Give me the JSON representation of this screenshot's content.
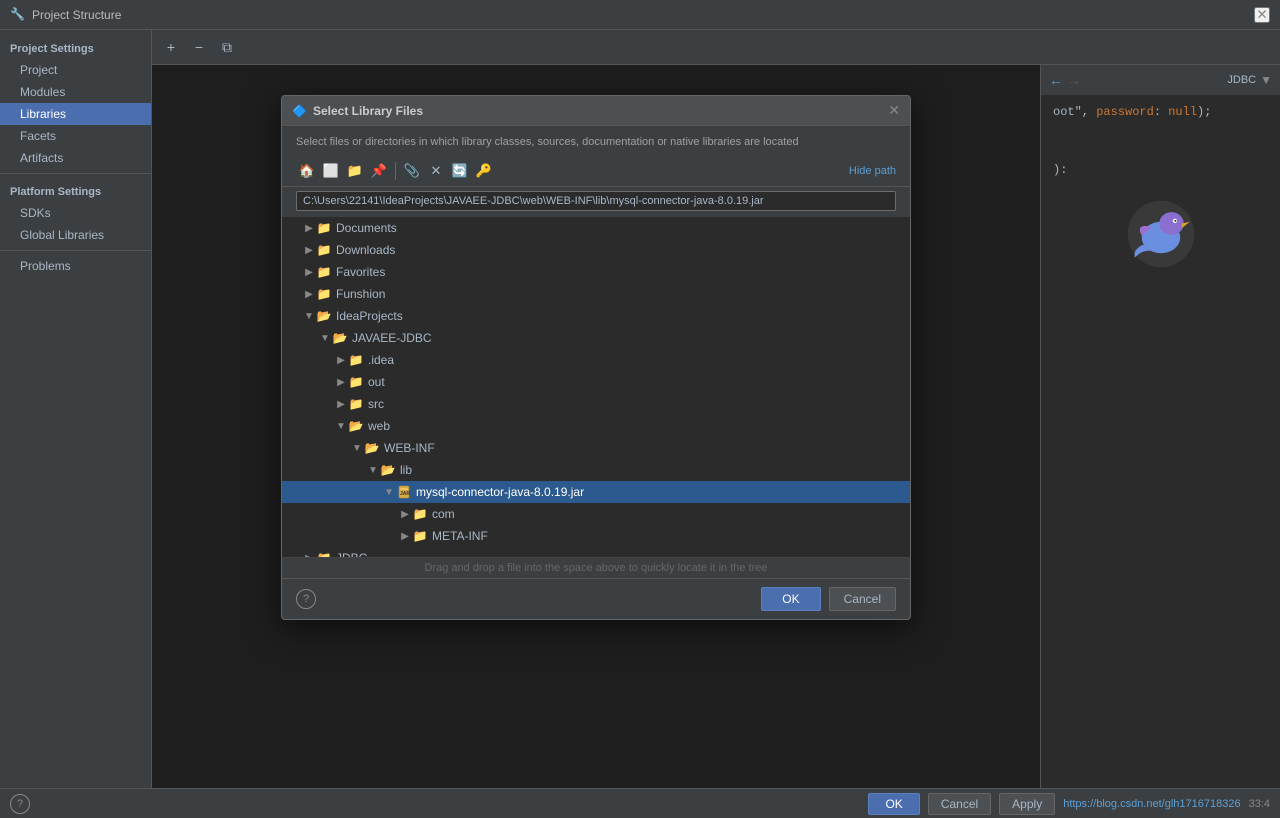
{
  "titlebar": {
    "icon": "🔧",
    "title": "Project Structure",
    "close_label": "✕"
  },
  "sidebar": {
    "project_settings_title": "Project Settings",
    "items_project": [
      {
        "id": "project",
        "label": "Project"
      },
      {
        "id": "modules",
        "label": "Modules"
      },
      {
        "id": "libraries",
        "label": "Libraries",
        "active": true
      },
      {
        "id": "facets",
        "label": "Facets"
      },
      {
        "id": "artifacts",
        "label": "Artifacts"
      }
    ],
    "platform_settings_title": "Platform Settings",
    "items_platform": [
      {
        "id": "sdks",
        "label": "SDKs"
      },
      {
        "id": "global-libraries",
        "label": "Global Libraries"
      }
    ],
    "problems_label": "Problems"
  },
  "toolbar": {
    "add_label": "+",
    "remove_label": "−",
    "copy_label": "⧉"
  },
  "right_panel": {
    "tab_label": "JDBC",
    "code_lines": [
      {
        "text": "oot\", password: null);"
      }
    ],
    "line_col": "33:4"
  },
  "dialog": {
    "title": "Select Library Files",
    "icon": "🔷",
    "description": "Select files or directories in which library classes, sources, documentation or native libraries are located",
    "hide_path_label": "Hide path",
    "path_value": "C:\\Users\\22141\\IdeaProjects\\JAVAEE-JDBC\\web\\WEB-INF\\lib\\mysql-connector-java-8.0.19.jar",
    "toolbar_btns": [
      "🏠",
      "⬜",
      "📁",
      "📌",
      "📎",
      "✕",
      "🔄",
      "🔑"
    ],
    "tree_items": [
      {
        "id": "documents",
        "label": "Documents",
        "depth": 1,
        "type": "folder-closed",
        "expanded": false,
        "toggle": "▶"
      },
      {
        "id": "downloads",
        "label": "Downloads",
        "depth": 1,
        "type": "folder-closed",
        "expanded": false,
        "toggle": "▶"
      },
      {
        "id": "favorites",
        "label": "Favorites",
        "depth": 1,
        "type": "folder-closed",
        "expanded": false,
        "toggle": "▶"
      },
      {
        "id": "funshion",
        "label": "Funshion",
        "depth": 1,
        "type": "folder-closed",
        "expanded": false,
        "toggle": "▶"
      },
      {
        "id": "ideaprojects",
        "label": "IdeaProjects",
        "depth": 1,
        "type": "folder-open",
        "expanded": true,
        "toggle": "▼"
      },
      {
        "id": "javaee-jdbc",
        "label": "JAVAEE-JDBC",
        "depth": 2,
        "type": "folder-open",
        "expanded": true,
        "toggle": "▼"
      },
      {
        "id": "idea",
        "label": ".idea",
        "depth": 3,
        "type": "folder-closed",
        "expanded": false,
        "toggle": "▶"
      },
      {
        "id": "out",
        "label": "out",
        "depth": 3,
        "type": "folder-closed",
        "expanded": false,
        "toggle": "▶"
      },
      {
        "id": "src",
        "label": "src",
        "depth": 3,
        "type": "folder-closed",
        "expanded": false,
        "toggle": "▶"
      },
      {
        "id": "web",
        "label": "web",
        "depth": 3,
        "type": "folder-open",
        "expanded": true,
        "toggle": "▼"
      },
      {
        "id": "webinf",
        "label": "WEB-INF",
        "depth": 4,
        "type": "folder-open",
        "expanded": true,
        "toggle": "▼"
      },
      {
        "id": "lib",
        "label": "lib",
        "depth": 5,
        "type": "folder-open",
        "expanded": true,
        "toggle": "▼"
      },
      {
        "id": "mysql-jar",
        "label": "mysql-connector-java-8.0.19.jar",
        "depth": 6,
        "type": "jar",
        "expanded": true,
        "toggle": "▼",
        "selected": true
      },
      {
        "id": "com",
        "label": "com",
        "depth": 7,
        "type": "folder-closed",
        "expanded": false,
        "toggle": "▶"
      },
      {
        "id": "meta-inf",
        "label": "META-INF",
        "depth": 7,
        "type": "folder-closed",
        "expanded": false,
        "toggle": "▶"
      },
      {
        "id": "jdbc",
        "label": "JDBC",
        "depth": 1,
        "type": "folder-closed",
        "expanded": false,
        "toggle": "▶"
      }
    ],
    "drag_hint": "Drag and drop a file into the space above to quickly locate it in the tree",
    "ok_label": "OK",
    "cancel_label": "Cancel",
    "help_label": "?"
  },
  "status_bar": {
    "ok_label": "OK",
    "cancel_label": "Cancel",
    "apply_label": "Apply",
    "url": "https://blog.csdn.net/glh1716718326",
    "line_col": "33:4",
    "help_label": "?"
  }
}
